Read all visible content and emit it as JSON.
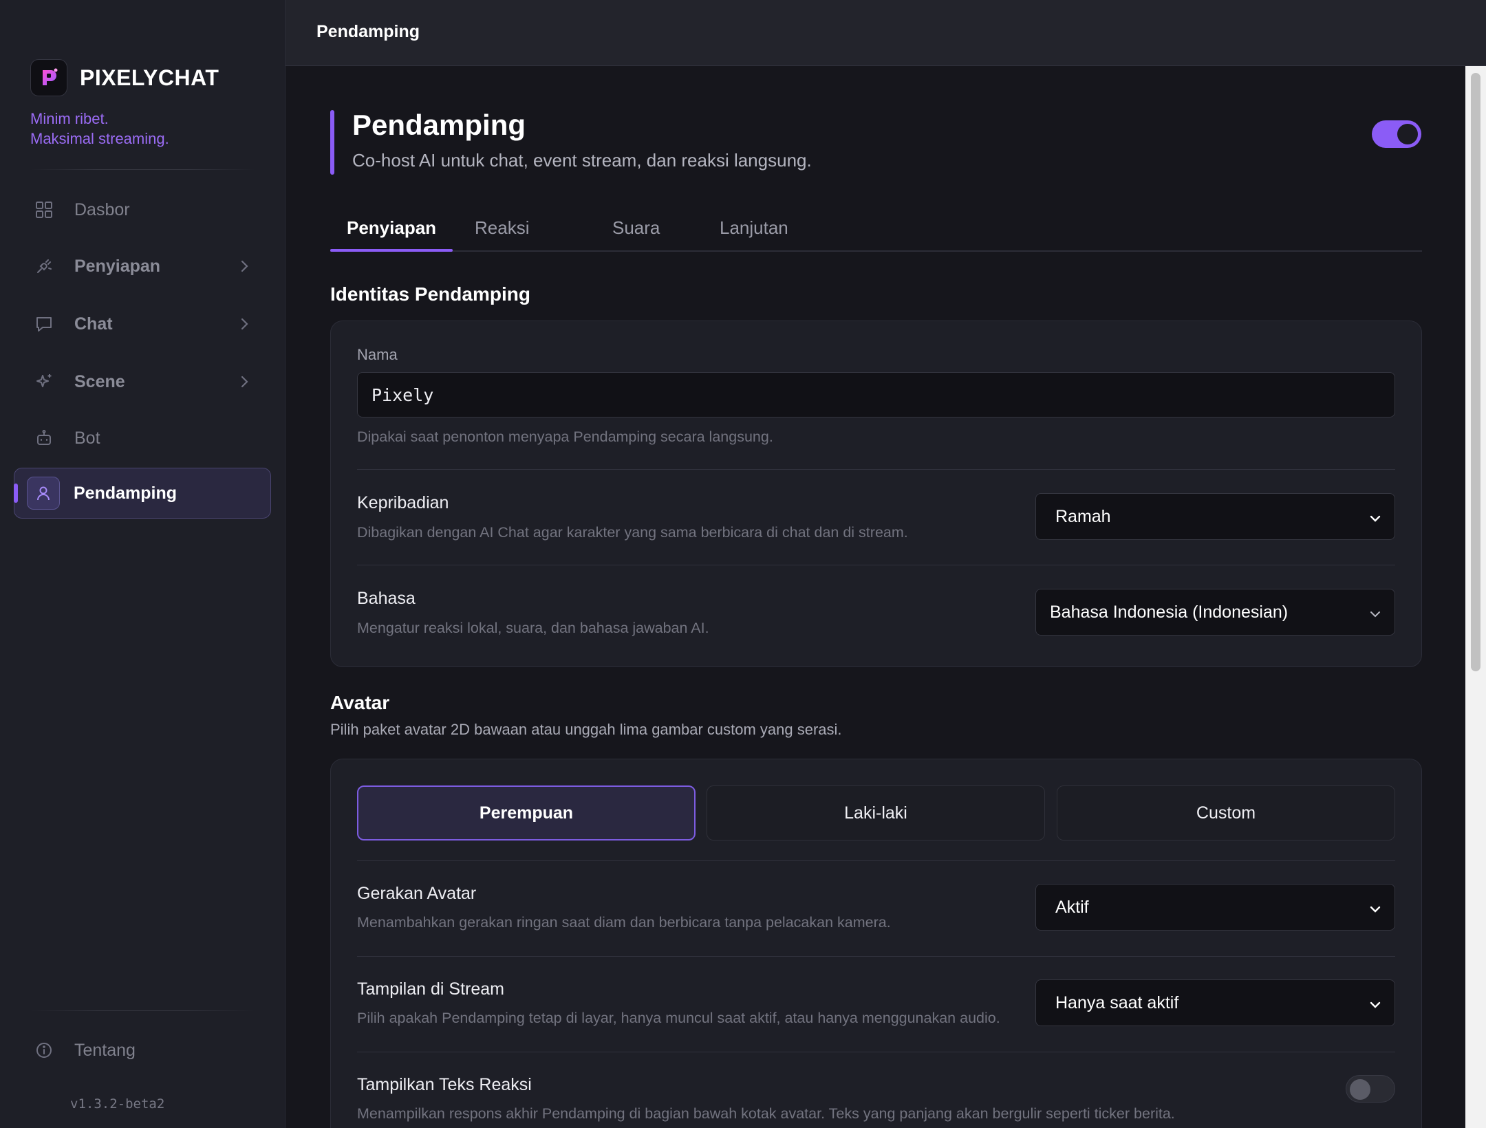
{
  "sidebar": {
    "brand_name": "PIXELYCHAT",
    "tagline_line1": "Minim ribet.",
    "tagline_line2": "Maksimal streaming.",
    "items": [
      {
        "label": "Dasbor",
        "icon": "grid-icon"
      },
      {
        "label": "Penyiapan",
        "icon": "plug-icon"
      },
      {
        "label": "Chat",
        "icon": "chat-icon"
      },
      {
        "label": "Scene",
        "icon": "sparkle-icon"
      },
      {
        "label": "Bot",
        "icon": "robot-icon"
      },
      {
        "label": "Pendamping",
        "icon": "user-icon",
        "active": true
      }
    ],
    "about_label": "Tentang",
    "version": "v1.3.2-beta2"
  },
  "topbar": {
    "title": "Pendamping"
  },
  "header": {
    "title": "Pendamping",
    "subtitle": "Co-host AI untuk chat, event stream, dan reaksi langsung.",
    "enabled": true
  },
  "tabs": [
    "Penyiapan",
    "Reaksi",
    "Suara",
    "Lanjutan"
  ],
  "identity": {
    "title": "Identitas Pendamping",
    "name_label": "Nama",
    "name_value": "Pixely",
    "name_hint": "Dipakai saat penonton menyapa Pendamping secara langsung.",
    "personality_title": "Kepribadian",
    "personality_desc": "Dibagikan dengan AI Chat agar karakter yang sama berbicara di chat dan di stream.",
    "personality_value": "Ramah",
    "language_title": "Bahasa",
    "language_desc": "Mengatur reaksi lokal, suara, dan bahasa jawaban AI.",
    "language_value": "Bahasa Indonesia (Indonesian)"
  },
  "avatar": {
    "title": "Avatar",
    "desc": "Pilih paket avatar 2D bawaan atau unggah lima gambar custom yang serasi.",
    "options": [
      "Perempuan",
      "Laki-laki",
      "Custom"
    ],
    "selected": "Perempuan",
    "motion_title": "Gerakan Avatar",
    "motion_desc": "Menambahkan gerakan ringan saat diam dan berbicara tanpa pelacakan kamera.",
    "motion_value": "Aktif",
    "display_title": "Tampilan di Stream",
    "display_desc": "Pilih apakah Pendamping tetap di layar, hanya muncul saat aktif, atau hanya menggunakan audio.",
    "display_value": "Hanya saat aktif",
    "reaction_text_title": "Tampilkan Teks Reaksi",
    "reaction_text_desc": "Menampilkan respons akhir Pendamping di bagian bawah kotak avatar. Teks yang panjang akan bergulir seperti ticker berita.",
    "reaction_text_enabled": false
  },
  "colors": {
    "accent": "#8b5cf6",
    "tagline": "#9b6cf5"
  }
}
